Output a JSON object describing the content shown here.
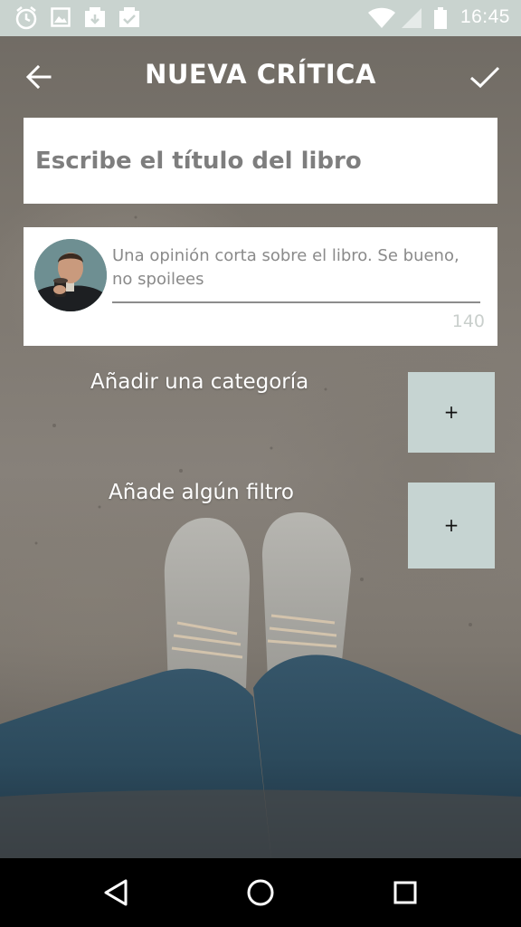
{
  "status_bar": {
    "time": "16:45",
    "left_icons": [
      "alarm-icon",
      "image-icon",
      "download-icon",
      "checked-icon"
    ],
    "right_icons": [
      "wifi-icon",
      "cell-signal-icon",
      "battery-icon"
    ]
  },
  "toolbar": {
    "title": "NUEVA CRÍTICA",
    "back_icon": "arrow-left-icon",
    "confirm_icon": "check-icon"
  },
  "title_input": {
    "placeholder": "Escribe el título del libro",
    "value": ""
  },
  "review": {
    "placeholder": "Una opinión corta sobre el libro. Se bueno, no spoilees",
    "value": "",
    "char_count": "140"
  },
  "options": {
    "category_label": "Añadir una categoría",
    "category_button": "+",
    "filter_label": "Añade algún filtro",
    "filter_button": "+"
  },
  "nav_bar": {
    "icons": [
      "back-triangle-icon",
      "home-circle-icon",
      "recents-square-icon"
    ]
  },
  "colors": {
    "status_bar": "#c9d3cf",
    "add_button": "#c6d4d2",
    "card": "#ffffff"
  }
}
